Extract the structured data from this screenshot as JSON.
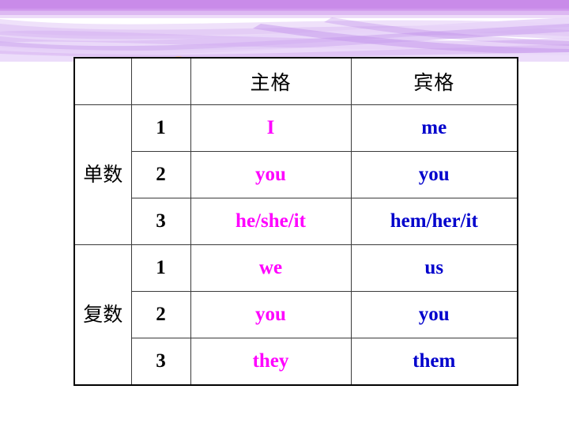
{
  "slide": {
    "background_color": "#ffffff",
    "banner": {
      "name": "purple-ribbon-banner",
      "colors": {
        "band_top": "#c88ae8",
        "ribbon_mid": "#c9a0ec",
        "ribbon_light": "#e3cdf6",
        "ribbon_pale": "#f0e4fa"
      }
    },
    "decorations": [
      {
        "name": "orange-circle",
        "color": "#f6c3a2"
      },
      {
        "name": "yellow-circle",
        "color": "#f7dd93"
      },
      {
        "name": "blue-circle",
        "color": "#a9cdf0"
      },
      {
        "name": "green-circle",
        "color": "#b7e2ad"
      }
    ]
  },
  "table": {
    "name": "pronoun-case-table",
    "border_color": "#000000",
    "subject_color": "#ff00ff",
    "object_color": "#0000cc",
    "headers": {
      "col_group": "",
      "col_person": "",
      "col_subject": "主格",
      "col_object": "宾格"
    },
    "groups": [
      {
        "label": "单数",
        "rows": [
          {
            "person": "1",
            "subject": "I",
            "object": "me"
          },
          {
            "person": "2",
            "subject": "you",
            "object": "you"
          },
          {
            "person": "3",
            "subject": "he/she/it",
            "object": "hem/her/it"
          }
        ]
      },
      {
        "label": "复数",
        "rows": [
          {
            "person": "1",
            "subject": "we",
            "object": "us"
          },
          {
            "person": "2",
            "subject": "you",
            "object": "you"
          },
          {
            "person": "3",
            "subject": "they",
            "object": "them"
          }
        ]
      }
    ]
  }
}
